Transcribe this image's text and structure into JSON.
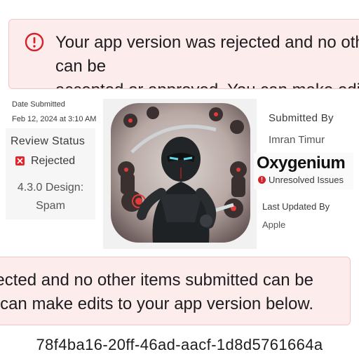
{
  "banner_top": {
    "message": "Your app version was rejected and no other items submitted can be\naccepted or approved. You can make edits to your app version below."
  },
  "banner_bottom": {
    "message": "Your app version was rejected and no other items submitted can be\naccepted or approved. You can make edits to your app version below."
  },
  "submission": {
    "date_label": "Date Submitted",
    "date_value": "Feb 12, 2024 at 3:10 AM"
  },
  "review": {
    "title": "Review Status",
    "status": "Rejected",
    "reason": "4.3.0 Design:\nSpam"
  },
  "app": {
    "icon_name": "ninja-app-icon",
    "name": "Oxygenium",
    "issue_text": "Unresolved Issues",
    "submitted_by_label": "Submitted By",
    "submitted_by_value": "Imran Timur",
    "last_updated_label": "Last Updated By",
    "last_updated_value": "Apple"
  },
  "footer": {
    "uuid": "78f4ba16-20ff-46ad-aacf-1d8d5761664a"
  },
  "colors": {
    "banner_bg": "#fdecec",
    "error_red": "#e0242b"
  }
}
